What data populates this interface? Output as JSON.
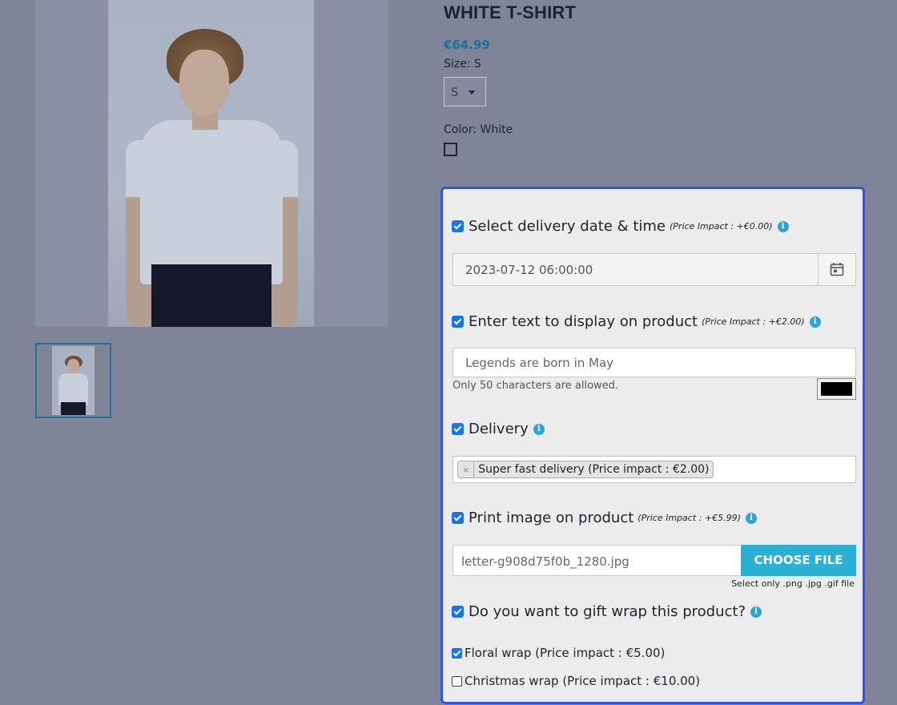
{
  "product": {
    "title": "WHITE T-SHIRT",
    "price": "€64.99",
    "size_label": "Size: S",
    "size_selected": "S",
    "color_label": "Color: White"
  },
  "customization": {
    "delivery_datetime": {
      "label": "Select delivery date & time",
      "impact": "(Price Impact : +€0.00)",
      "checked": true,
      "value": "2023-07-12 06:00:00"
    },
    "custom_text": {
      "label": "Enter text to display on product",
      "impact": "(Price Impact : +€2.00)",
      "checked": true,
      "value": "Legends are born in May",
      "hint": "Only 50 characters are allowed.",
      "text_color": "#000000"
    },
    "delivery": {
      "label": "Delivery",
      "checked": true,
      "selected_tag": "Super fast delivery (Price impact : €2.00)",
      "remove_glyph": "×"
    },
    "print_image": {
      "label": "Print image on product",
      "impact": "(Price Impact : +€5.99)",
      "checked": true,
      "file_name": "letter-g908d75f0b_1280.jpg",
      "button_label": "CHOOSE FILE",
      "hint": "Select only .png .jpg .gif file"
    },
    "gift_wrap": {
      "label": "Do you want to gift wrap this product?",
      "checked": true,
      "options": [
        {
          "label": "Floral wrap (Price impact : €5.00)",
          "checked": true
        },
        {
          "label": "Christmas wrap (Price impact : €10.00)",
          "checked": false
        }
      ]
    },
    "info_glyph": "i"
  },
  "colors": {
    "panel_border": "#2e55e8",
    "accent_checkbox": "#1a73e8",
    "price": "#1f6f98",
    "choose_file_button": "#2ab0d4",
    "info_icon": "#2ea3d8"
  }
}
